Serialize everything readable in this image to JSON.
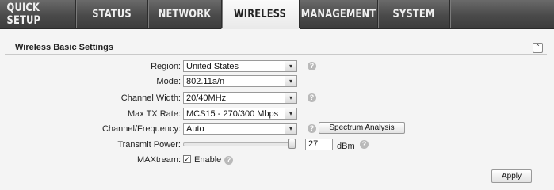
{
  "nav": {
    "tabs": [
      {
        "label": "QUICK SETUP"
      },
      {
        "label": "STATUS"
      },
      {
        "label": "NETWORK"
      },
      {
        "label": "WIRELESS",
        "active": true
      },
      {
        "label": "MANAGEMENT"
      },
      {
        "label": "SYSTEM"
      }
    ]
  },
  "panel": {
    "title": "Wireless Basic Settings",
    "collapse_icon": "double-chevron-up-icon"
  },
  "fields": {
    "region": {
      "label": "Region:",
      "value": "United States"
    },
    "mode": {
      "label": "Mode:",
      "value": "802.11a/n"
    },
    "channel_width": {
      "label": "Channel Width:",
      "value": "20/40MHz"
    },
    "max_tx_rate": {
      "label": "Max TX Rate:",
      "value": "MCS15 - 270/300 Mbps"
    },
    "channel_frequency": {
      "label": "Channel/Frequency:",
      "value": "Auto"
    },
    "transmit_power": {
      "label": "Transmit Power:",
      "value": "27",
      "unit": "dBm",
      "level": 1.0
    },
    "maxtream": {
      "label": "MAXtream:",
      "checkbox_label": "Enable",
      "checked": true
    }
  },
  "buttons": {
    "spectrum_analysis": "Spectrum Analysis",
    "apply": "Apply"
  },
  "help_glyph": "?",
  "dropdown_glyph": "▾",
  "checkmark_glyph": "✓",
  "collapse_glyph": "⌃"
}
